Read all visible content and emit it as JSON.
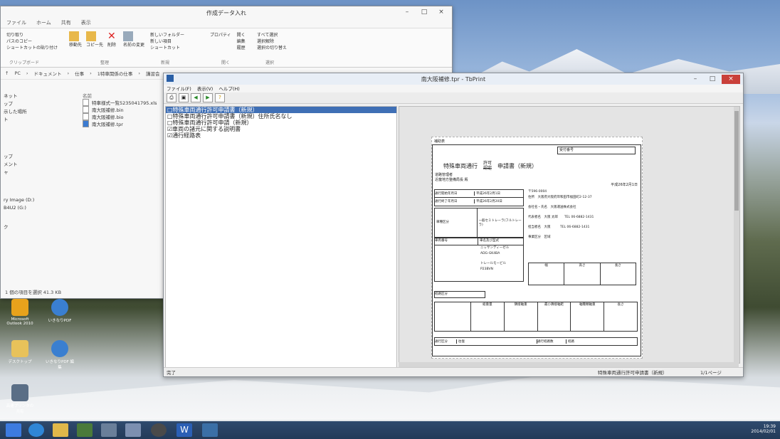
{
  "explorer": {
    "title": "作成データ入れ",
    "tabs": [
      "ファイル",
      "ホーム",
      "共有",
      "表示"
    ],
    "ribbon": {
      "clipboard": [
        "切り取り",
        "パスのコピー",
        "ショートカットの貼り付け"
      ],
      "clipboard_label": "クリップボード",
      "organize": [
        "移動先",
        "コピー先",
        "削除",
        "名前の変更"
      ],
      "organize_label": "整理",
      "new": [
        "新しいフォルダー",
        "新しい項目",
        "ショートカット"
      ],
      "new_label": "新規",
      "open": [
        "プロパティ",
        "開く",
        "編集",
        "履歴"
      ],
      "open_label": "開く",
      "select": [
        "すべて選択",
        "選択解除",
        "選択の切り替え"
      ],
      "select_label": "選択"
    },
    "breadcrumb": [
      "PC",
      "ドキュメント",
      "仕事",
      "1特車関係の仕事",
      "講習会"
    ],
    "column_name": "名前",
    "nav_items": [
      "ネット",
      "ップ",
      "示した場所",
      "ト",
      "ップ",
      "メント",
      "ャ",
      "ry Image (D:)",
      "B4U2 (G:)",
      "ク"
    ],
    "files": [
      "特車様式一覧5235041795.xls",
      "南大阪補修.bin",
      "南大阪補修.bio",
      "南大阪補修.tpr"
    ],
    "status": "1 個の項目を選択  41.3 KB"
  },
  "tbprint": {
    "title": "南大阪補修.tpr - TbPrint",
    "menu": [
      "ファイル(F)",
      "表示(V)",
      "ヘルプ(H)"
    ],
    "tree": [
      {
        "label": "□特殊車両通行許可申請書（新規）",
        "checked": false,
        "selected": true
      },
      {
        "label": "□特殊車両通行許可申請書（新規）住所氏名なし",
        "checked": false,
        "selected": false
      },
      {
        "label": "□特殊車両通行許可申請（新規）",
        "checked": false,
        "selected": false
      },
      {
        "label": "☑車両の諸元に関する説明書",
        "checked": true,
        "selected": false
      },
      {
        "label": "☑通行経路表",
        "checked": true,
        "selected": false
      }
    ],
    "status_doc": "特殊車両通行許可申請書（新規）",
    "status_page": "1/1ページ",
    "status_left": "完了"
  },
  "form": {
    "top_label": "補助表",
    "receipt": "受付番号",
    "title_left": "特殊車両通行",
    "title_kyoka": "許可",
    "title_nintei": "認定",
    "title_right": "申請書（新規）",
    "to": "道路管理者",
    "to2": "近畿地方整備局長 殿",
    "date": "平成26年2月1日",
    "start": "通行開始年月日",
    "start_val": "平成26年2月1日",
    "end": "通行終了年月日",
    "end_val": "平成26年2月20日",
    "zip": "〒596-0004",
    "addr_label": "住所",
    "addr_val": "大阪府大阪府岸和田市福田町2-12-37",
    "company_label": "会社名・氏名",
    "company_val": "大阪運送株式会社",
    "rep_label": "代表者名",
    "rep_val": "大阪 太郎",
    "tel1": "TEL 06-6882-1431",
    "contact_label": "担当者名",
    "contact_val": "大阪",
    "tel2": "TEL 06-6882-1431",
    "biz_label": "事業区分",
    "biz_val": "区域",
    "vehicle_label": "車種区分",
    "vehicle_val": "一般セミトレーラ(フルトレーラ)",
    "reg_label": "車両番号",
    "reg_val": "車名及び型式",
    "truck_name": "ニッサンディーゼル",
    "truck_type": "ADG-GK4BA",
    "trailer_name": "トレールモービル",
    "trailer_type": "P23BVN",
    "dims_headers": [
      "幅",
      "高さ",
      "長さ"
    ],
    "route_label": "経路区分",
    "cargo_headers": [
      "総重量",
      "隣接軸重",
      "最小隣接軸距",
      "軸種類軸重",
      "長さ"
    ],
    "pass_label": "通行区分",
    "pass_val": "往復",
    "route_count_label": "通行経路数",
    "route_count_val": "経路"
  },
  "desktop_icons": [
    "Microsoft Outlook 2010",
    "いきなりPDF",
    "デスクトップ",
    "いきなりPDF 編集",
    "高速プリンタの共有"
  ],
  "tray": {
    "time": "19:39",
    "date": "2014/02/01"
  }
}
